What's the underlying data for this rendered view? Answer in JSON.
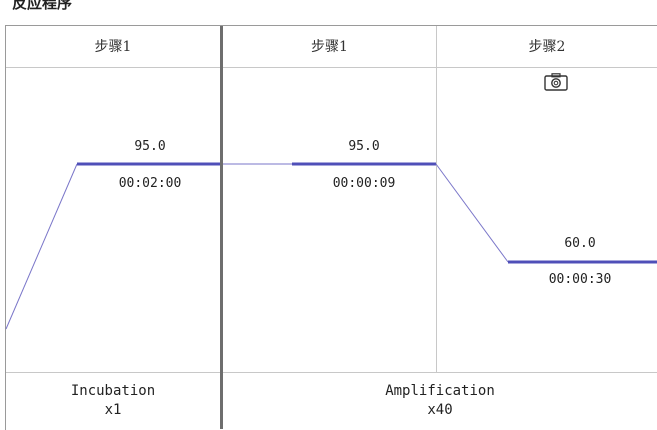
{
  "panel_title": "反应程序",
  "columns": [
    {
      "header": "步骤1"
    },
    {
      "header": "步骤1"
    },
    {
      "header": "步骤2"
    }
  ],
  "steps": [
    {
      "temperature": "95.0",
      "time": "00:02:00"
    },
    {
      "temperature": "95.0",
      "time": "00:00:09"
    },
    {
      "temperature": "60.0",
      "time": "00:00:30"
    }
  ],
  "stages": [
    {
      "name": "Incubation",
      "cycles": "x1"
    },
    {
      "name": "Amplification",
      "cycles": "x40"
    }
  ],
  "icons": {
    "capture": "camera-icon"
  },
  "colors": {
    "line": "#7a76c9",
    "hold": "#4f4fb8",
    "grid": "#c8c8c8",
    "divider": "#6e6e6e"
  }
}
